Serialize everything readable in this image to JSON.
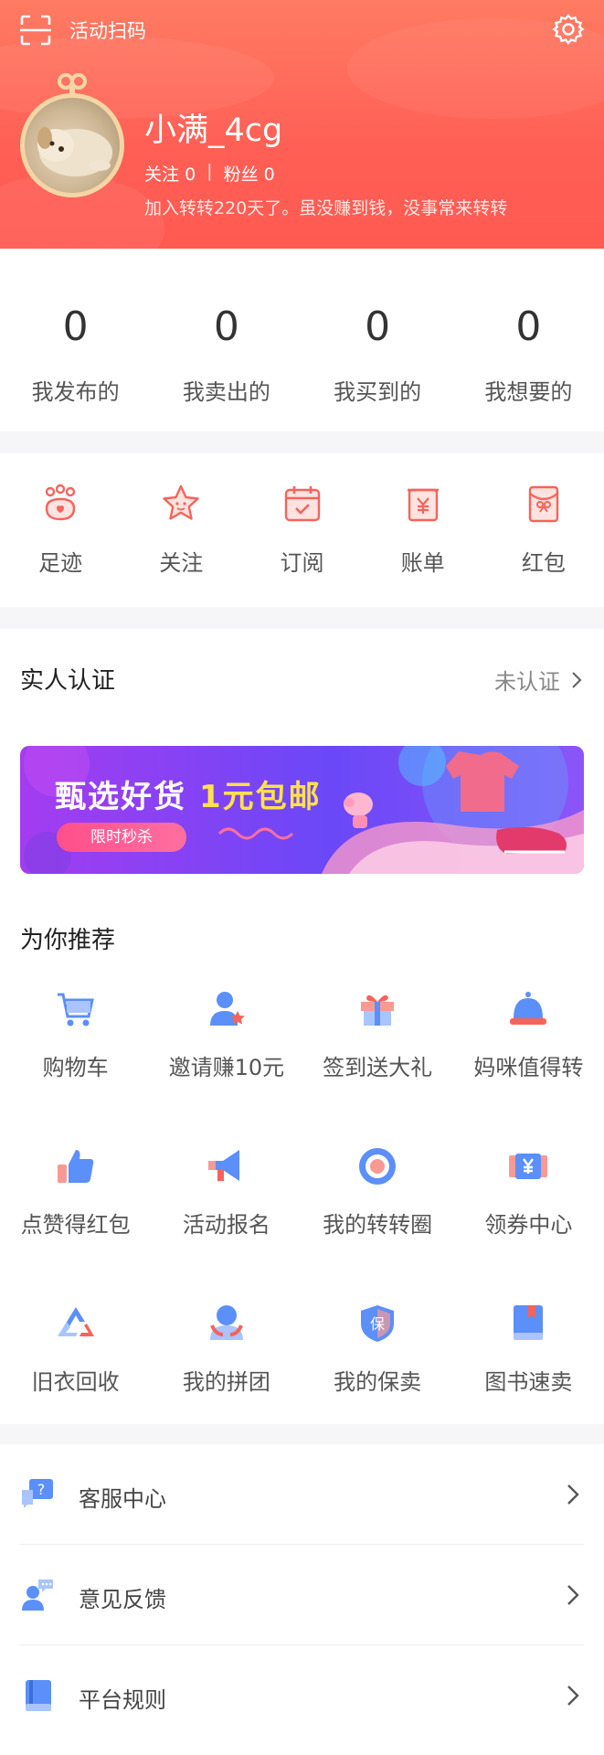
{
  "header": {
    "scan_label": "活动扫码",
    "username": "小满_4cg",
    "follow_label": "关注",
    "follow_count": "0",
    "fans_label": "粉丝",
    "fans_count": "0",
    "separator": "|",
    "join_text": "加入转转220天了。虽没赚到钱，没事常来转转"
  },
  "stats": [
    {
      "value": "0",
      "label": "我发布的"
    },
    {
      "value": "0",
      "label": "我卖出的"
    },
    {
      "value": "0",
      "label": "我买到的"
    },
    {
      "value": "0",
      "label": "我想要的"
    }
  ],
  "tools": [
    {
      "label": "足迹",
      "icon": "paw-icon"
    },
    {
      "label": "关注",
      "icon": "star-icon"
    },
    {
      "label": "订阅",
      "icon": "calendar-icon"
    },
    {
      "label": "账单",
      "icon": "bill-icon"
    },
    {
      "label": "红包",
      "icon": "red-envelope-icon"
    }
  ],
  "verify": {
    "title": "实人认证",
    "status": "未认证"
  },
  "banner": {
    "title_part1": "甄选好货",
    "title_part2": "1元包邮",
    "pill": "限时秒杀"
  },
  "recommend": {
    "title": "为你推荐",
    "items": [
      {
        "label": "购物车",
        "icon": "cart-icon"
      },
      {
        "label": "邀请赚10元",
        "icon": "invite-icon"
      },
      {
        "label": "签到送大礼",
        "icon": "gift-icon"
      },
      {
        "label": "妈咪值得转",
        "icon": "bell-icon"
      },
      {
        "label": "点赞得红包",
        "icon": "thumbs-up-icon"
      },
      {
        "label": "活动报名",
        "icon": "megaphone-icon"
      },
      {
        "label": "我的转转圈",
        "icon": "circle-icon"
      },
      {
        "label": "领券中心",
        "icon": "coupon-icon"
      },
      {
        "label": "旧衣回收",
        "icon": "recycle-icon"
      },
      {
        "label": "我的拼团",
        "icon": "group-icon"
      },
      {
        "label": "我的保卖",
        "icon": "shield-icon"
      },
      {
        "label": "图书速卖",
        "icon": "book-icon"
      }
    ]
  },
  "menu": [
    {
      "label": "客服中心",
      "icon": "customer-service-icon"
    },
    {
      "label": "意见反馈",
      "icon": "feedback-icon"
    },
    {
      "label": "平台规则",
      "icon": "rules-icon"
    }
  ],
  "colors": {
    "header": "#ff5f55",
    "accent_red": "#f4645a",
    "icon_blue": "#5b8ff9",
    "banner_purple": "#8b55f8",
    "banner_yellow": "#ffe14a"
  }
}
